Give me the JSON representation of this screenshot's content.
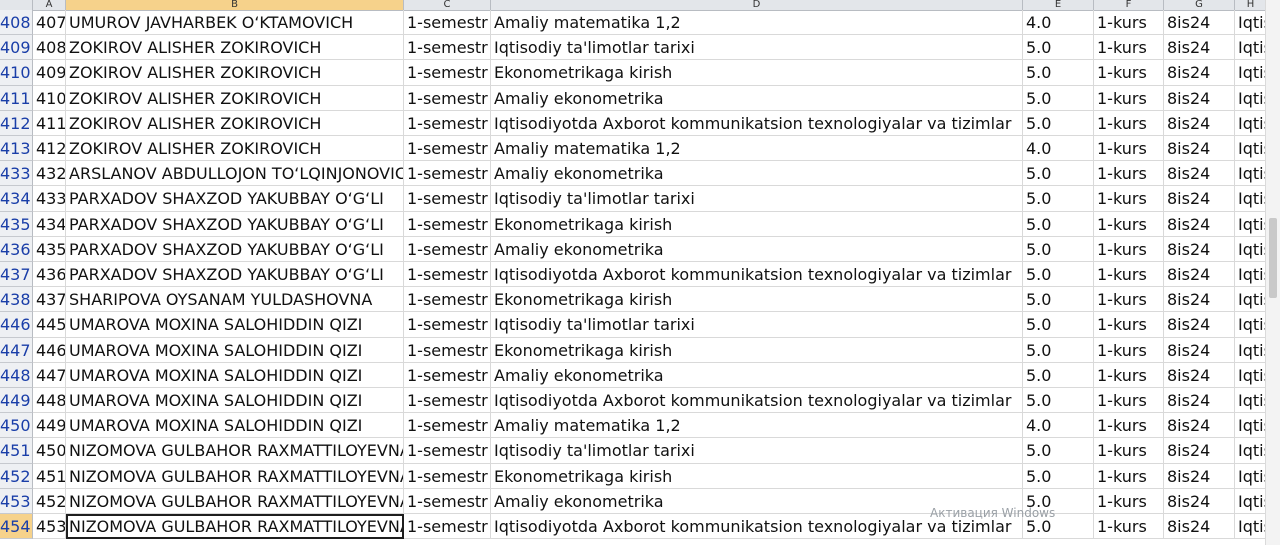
{
  "column_headers": [
    "A",
    "B",
    "C",
    "D",
    "E",
    "F",
    "G",
    "H"
  ],
  "rows": [
    {
      "rownum": "408",
      "a": "407",
      "name": "UMUROV JAVHARBEK O‘KTAMOVICH",
      "semester": "1-semestr",
      "subject": "Amaliy matematika 1,2",
      "grade": "4.0",
      "course": "1-kurs",
      "group": "8is24",
      "extra": "Iqtis"
    },
    {
      "rownum": "409",
      "a": "408",
      "name": "ZOKIROV ALISHER ZOKIROVICH",
      "semester": "1-semestr",
      "subject": "Iqtisodiy ta'limotlar tarixi",
      "grade": "5.0",
      "course": "1-kurs",
      "group": "8is24",
      "extra": "Iqtis"
    },
    {
      "rownum": "410",
      "a": "409",
      "name": "ZOKIROV ALISHER ZOKIROVICH",
      "semester": "1-semestr",
      "subject": "Ekonometrikaga kirish",
      "grade": "5.0",
      "course": "1-kurs",
      "group": "8is24",
      "extra": "Iqtis"
    },
    {
      "rownum": "411",
      "a": "410",
      "name": "ZOKIROV ALISHER ZOKIROVICH",
      "semester": "1-semestr",
      "subject": "Amaliy ekonometrika",
      "grade": "5.0",
      "course": "1-kurs",
      "group": "8is24",
      "extra": "Iqtis"
    },
    {
      "rownum": "412",
      "a": "411",
      "name": "ZOKIROV ALISHER ZOKIROVICH",
      "semester": "1-semestr",
      "subject": "Iqtisodiyotda Axborot kommunikatsion texnologiyalar va tizimlar",
      "grade": "5.0",
      "course": "1-kurs",
      "group": "8is24",
      "extra": "Iqtis"
    },
    {
      "rownum": "413",
      "a": "412",
      "name": "ZOKIROV ALISHER ZOKIROVICH",
      "semester": "1-semestr",
      "subject": "Amaliy matematika 1,2",
      "grade": "4.0",
      "course": "1-kurs",
      "group": "8is24",
      "extra": "Iqtis"
    },
    {
      "rownum": "433",
      "a": "432",
      "name": "ARSLANOV ABDULLOJON TO‘LQINJONOVICH",
      "semester": "1-semestr",
      "subject": "Amaliy ekonometrika",
      "grade": "5.0",
      "course": "1-kurs",
      "group": "8is24",
      "extra": "Iqtis"
    },
    {
      "rownum": "434",
      "a": "433",
      "name": "PARXADOV SHAXZOD YAKUBBAY O‘G‘LI",
      "semester": "1-semestr",
      "subject": "Iqtisodiy ta'limotlar tarixi",
      "grade": "5.0",
      "course": "1-kurs",
      "group": "8is24",
      "extra": "Iqtis"
    },
    {
      "rownum": "435",
      "a": "434",
      "name": "PARXADOV SHAXZOD YAKUBBAY O‘G‘LI",
      "semester": "1-semestr",
      "subject": "Ekonometrikaga kirish",
      "grade": "5.0",
      "course": "1-kurs",
      "group": "8is24",
      "extra": "Iqtis"
    },
    {
      "rownum": "436",
      "a": "435",
      "name": "PARXADOV SHAXZOD YAKUBBAY O‘G‘LI",
      "semester": "1-semestr",
      "subject": "Amaliy ekonometrika",
      "grade": "5.0",
      "course": "1-kurs",
      "group": "8is24",
      "extra": "Iqtis"
    },
    {
      "rownum": "437",
      "a": "436",
      "name": "PARXADOV SHAXZOD YAKUBBAY O‘G‘LI",
      "semester": "1-semestr",
      "subject": "Iqtisodiyotda Axborot kommunikatsion texnologiyalar va tizimlar",
      "grade": "5.0",
      "course": "1-kurs",
      "group": "8is24",
      "extra": "Iqtis"
    },
    {
      "rownum": "438",
      "a": "437",
      "name": "SHARIPOVA OYSANAM YULDASHOVNA",
      "semester": "1-semestr",
      "subject": "Ekonometrikaga kirish",
      "grade": "5.0",
      "course": "1-kurs",
      "group": "8is24",
      "extra": "Iqtis"
    },
    {
      "rownum": "446",
      "a": "445",
      "name": "UMAROVA MOXINA SALOHIDDIN QIZI",
      "semester": "1-semestr",
      "subject": "Iqtisodiy ta'limotlar tarixi",
      "grade": "5.0",
      "course": "1-kurs",
      "group": "8is24",
      "extra": "Iqtis"
    },
    {
      "rownum": "447",
      "a": "446",
      "name": "UMAROVA MOXINA SALOHIDDIN QIZI",
      "semester": "1-semestr",
      "subject": "Ekonometrikaga kirish",
      "grade": "5.0",
      "course": "1-kurs",
      "group": "8is24",
      "extra": "Iqtis"
    },
    {
      "rownum": "448",
      "a": "447",
      "name": "UMAROVA MOXINA SALOHIDDIN QIZI",
      "semester": "1-semestr",
      "subject": "Amaliy ekonometrika",
      "grade": "5.0",
      "course": "1-kurs",
      "group": "8is24",
      "extra": "Iqtis"
    },
    {
      "rownum": "449",
      "a": "448",
      "name": "UMAROVA MOXINA SALOHIDDIN QIZI",
      "semester": "1-semestr",
      "subject": "Iqtisodiyotda Axborot kommunikatsion texnologiyalar va tizimlar",
      "grade": "5.0",
      "course": "1-kurs",
      "group": "8is24",
      "extra": "Iqtis"
    },
    {
      "rownum": "450",
      "a": "449",
      "name": "UMAROVA MOXINA SALOHIDDIN QIZI",
      "semester": "1-semestr",
      "subject": "Amaliy matematika 1,2",
      "grade": "4.0",
      "course": "1-kurs",
      "group": "8is24",
      "extra": "Iqtis"
    },
    {
      "rownum": "451",
      "a": "450",
      "name": "NIZOMOVA GULBAHOR RAXMATTILOYEVNA",
      "semester": "1-semestr",
      "subject": "Iqtisodiy ta'limotlar tarixi",
      "grade": "5.0",
      "course": "1-kurs",
      "group": "8is24",
      "extra": "Iqtis"
    },
    {
      "rownum": "452",
      "a": "451",
      "name": "NIZOMOVA GULBAHOR RAXMATTILOYEVNA",
      "semester": "1-semestr",
      "subject": "Ekonometrikaga kirish",
      "grade": "5.0",
      "course": "1-kurs",
      "group": "8is24",
      "extra": "Iqtis"
    },
    {
      "rownum": "453",
      "a": "452",
      "name": "NIZOMOVA GULBAHOR RAXMATTILOYEVNA",
      "semester": "1-semestr",
      "subject": "Amaliy ekonometrika",
      "grade": "5.0",
      "course": "1-kurs",
      "group": "8is24",
      "extra": "Iqtis"
    },
    {
      "rownum": "454",
      "a": "453",
      "name": "NIZOMOVA GULBAHOR RAXMATTILOYEVNA",
      "semester": "1-semestr",
      "subject": "Iqtisodiyotda Axborot kommunikatsion texnologiyalar va tizimlar",
      "grade": "5.0",
      "course": "1-kurs",
      "group": "8is24",
      "extra": "Iqtis"
    }
  ],
  "active_row": "454",
  "watermark": {
    "line1": "Активация Windows"
  },
  "colors": {
    "selection": "#f6d28b",
    "row_number_text": "#1a3ea8",
    "gridline": "#d9d9d9"
  }
}
